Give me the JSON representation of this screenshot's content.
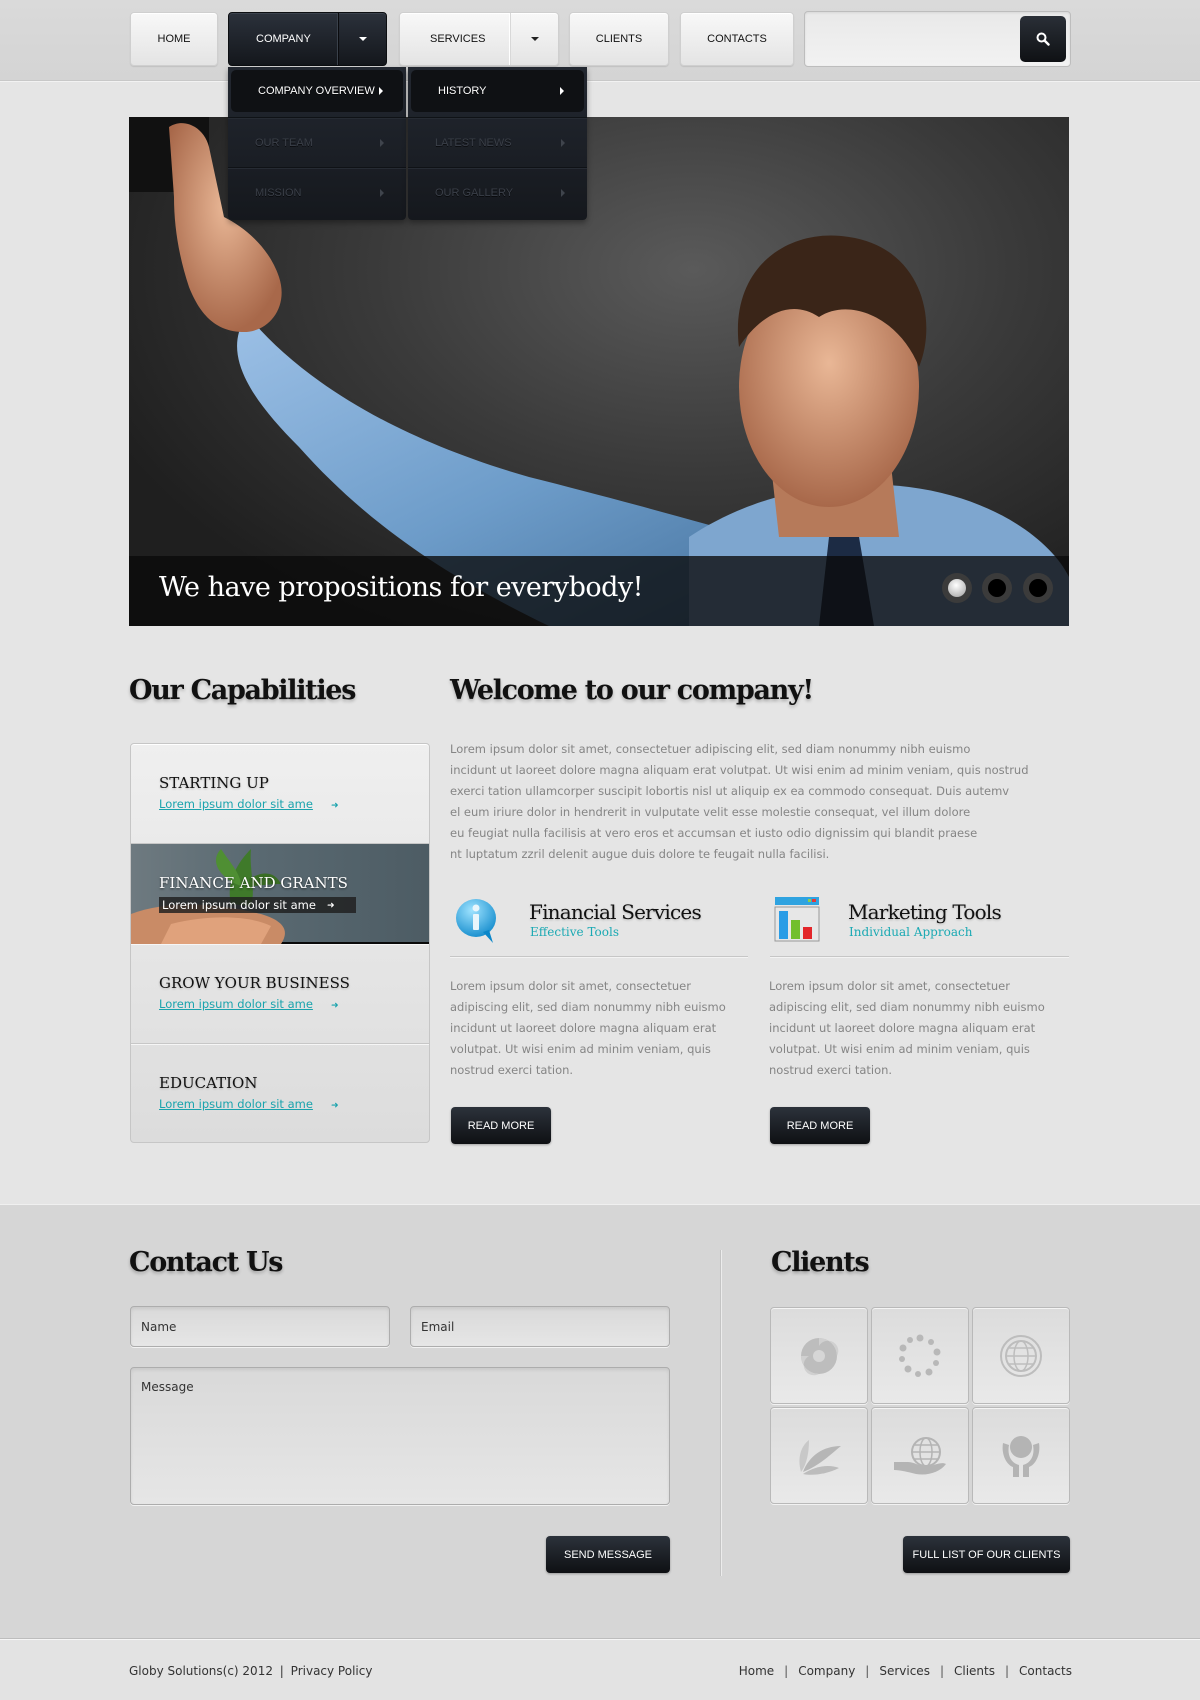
{
  "nav": {
    "items": [
      {
        "label": "HOME",
        "has_dropdown": false,
        "active": false
      },
      {
        "label": "COMPANY",
        "has_dropdown": true,
        "active": true
      },
      {
        "label": "SERVICES",
        "has_dropdown": true,
        "active": false
      },
      {
        "label": "CLIENTS",
        "has_dropdown": false,
        "active": false
      },
      {
        "label": "CONTACTS",
        "has_dropdown": false,
        "active": false
      }
    ],
    "search": {
      "value": "",
      "placeholder": "",
      "icon": "search-icon"
    },
    "dropdown": {
      "column1": [
        {
          "label": "COMPANY OVERVIEW",
          "active": true
        },
        {
          "label": "OUR TEAM",
          "active": false
        },
        {
          "label": "MISSION",
          "active": false
        }
      ],
      "column2": [
        {
          "label": "HISTORY",
          "active": true
        },
        {
          "label": "LATEST NEWS",
          "active": false
        },
        {
          "label": "OUR GALLERY",
          "active": false
        }
      ]
    }
  },
  "hero": {
    "caption": "We have propositions for everybody!",
    "slides_total": 3,
    "active_slide": 1
  },
  "capabilities": {
    "title": "Our Capabilities",
    "items": [
      {
        "title": "STARTING UP",
        "link": "Lorem ipsum dolor sit ame",
        "featured": false
      },
      {
        "title": "FINANCE AND GRANTS",
        "link": "Lorem ipsum dolor sit ame",
        "featured": true
      },
      {
        "title": "GROW YOUR BUSINESS",
        "link": "Lorem ipsum dolor sit ame",
        "featured": false
      },
      {
        "title": "EDUCATION",
        "link": "Lorem ipsum dolor sit ame",
        "featured": false
      }
    ]
  },
  "welcome": {
    "title": "Welcome to our company!",
    "paragraph_lines": [
      "Lorem ipsum dolor sit amet, consectetuer adipiscing elit, sed diam nonummy nibh euismo",
      "incidunt ut laoreet dolore magna aliquam erat volutpat. Ut wisi enim ad minim veniam, quis nostrud",
      "exerci tation ullamcorper suscipit lobortis nisl ut aliquip ex ea commodo consequat. Duis autemv",
      "el eum iriure dolor in hendrerit in vulputate velit esse molestie consequat, vel illum dolore",
      "eu feugiat nulla facilisis at vero eros et accumsan et iusto odio dignissim qui blandit praese",
      "nt luptatum zzril delenit augue duis dolore te feugait nulla facilisi."
    ],
    "features": [
      {
        "icon": "info-bubble-icon",
        "title": "Financial Services",
        "subtitle": "Effective Tools",
        "text_lines": [
          "Lorem ipsum dolor sit amet, consectetuer",
          "adipiscing elit, sed diam nonummy nibh euismo",
          "incidunt ut laoreet dolore magna aliquam erat",
          "volutpat. Ut wisi enim ad minim veniam, quis",
          "nostrud exerci tation."
        ],
        "button": "READ MORE"
      },
      {
        "icon": "bar-chart-window-icon",
        "title": "Marketing Tools",
        "subtitle": "Individual Approach",
        "text_lines": [
          "Lorem ipsum dolor sit amet, consectetuer",
          "adipiscing elit, sed diam nonummy nibh euismo",
          "incidunt ut laoreet dolore magna aliquam erat",
          "volutpat. Ut wisi enim ad minim veniam, quis",
          "nostrud exerci tation."
        ],
        "button": "READ MORE"
      }
    ]
  },
  "contact": {
    "title": "Contact Us",
    "name_placeholder": "Name",
    "email_placeholder": "Email",
    "message_placeholder": "Message",
    "name_value": "",
    "email_value": "",
    "message_value": "",
    "submit": "SEND MESSAGE"
  },
  "clients": {
    "title": "Clients",
    "logos": [
      "swirl-logo-icon",
      "dotted-ring-logo-icon",
      "globe-circle-logo-icon",
      "leaf-logo-icon",
      "hand-globe-logo-icon",
      "hands-sphere-logo-icon"
    ],
    "button": "FULL LIST OF OUR CLIENTS"
  },
  "footer": {
    "copyright": "Globy Solutions(c) 2012",
    "privacy": "Privacy Policy",
    "separator": "|",
    "links": [
      "Home",
      "Company",
      "Services",
      "Clients",
      "Contacts"
    ]
  },
  "colors": {
    "accent": "#1aa9b3",
    "dark_button": "#14171c",
    "background": "#e4e4e4"
  }
}
